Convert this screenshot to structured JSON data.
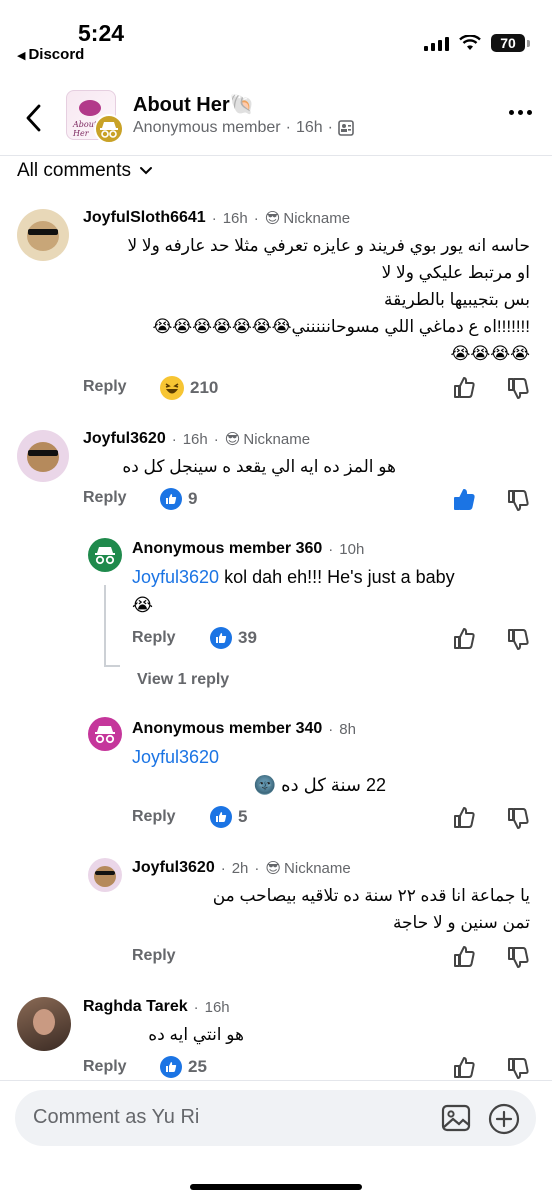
{
  "status_bar": {
    "time": "5:24",
    "back_app": "Discord",
    "battery": "70"
  },
  "header": {
    "title": "About Her",
    "title_emoji": "🐚",
    "group_image_text": "About Her",
    "subtitle_author": "Anonymous member",
    "subtitle_time": "16h",
    "subtitle_icon": "group-members-icon"
  },
  "sort": {
    "label": "All comments"
  },
  "labels": {
    "reply": "Reply",
    "nickname": "Nickname",
    "view_reply": "View 1 reply",
    "dot": "·"
  },
  "comments": [
    {
      "name": "JoyfulSloth6641",
      "time": "16h",
      "lines": [
        "حاسه انه يور بوي فريند و عايزه تعرفي مثلا حد عارفه ولا لا",
        "او مرتبط عليكي ولا لا",
        "بس بتجيبيها بالطريقة",
        "!!!!!!!اه ع دماغي اللي مسوحاننننني😭😭😭😭😭😭😭",
        "😭😭😭😭"
      ],
      "reaction": "haha",
      "count": "210"
    },
    {
      "name": "Joyful3620",
      "time": "16h",
      "text": "هو المز ده ايه الي يقعد ه سينجل كل ده",
      "reaction": "like",
      "count": "9"
    },
    {
      "name": "Anonymous member 360",
      "time": "10h",
      "mention": "Joyful3620",
      "text": " kol dah eh!!! He's just a baby",
      "line2": "😭",
      "reaction": "like",
      "count": "39"
    },
    {
      "name": "Anonymous member 340",
      "time": "8h",
      "mention": "Joyful3620",
      "text": "22 سنة كل ده 🌚",
      "reaction": "like",
      "count": "5"
    },
    {
      "name": "Joyful3620",
      "time": "2h",
      "lines": [
        "يا جماعة انا قده ٢٢ سنة ده تلاقيه بيصاحب من",
        "تمن سنين و لا حاجة"
      ]
    },
    {
      "name": "Raghda Tarek",
      "time": "16h",
      "text": "هو انتي ايه ده",
      "reaction": "like",
      "count": "25"
    }
  ],
  "composer": {
    "placeholder": "Comment as Yu Ri"
  },
  "colors": {
    "accent": "#1b74e4",
    "text": "#050505",
    "secondary": "#65676b"
  }
}
